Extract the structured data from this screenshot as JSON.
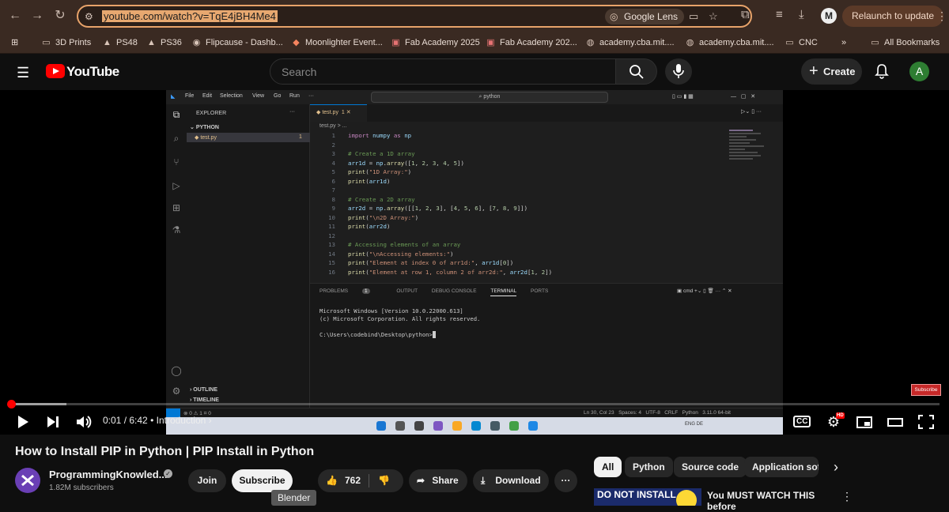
{
  "browser": {
    "url": "youtube.com/watch?v=TqE4jBH4Me4",
    "lens_label": "Google Lens",
    "relaunch_label": "Relaunch to update",
    "profile_letter": "M",
    "bookmarks": [
      "3D Prints",
      "PS48",
      "PS36",
      "Flipcause - Dashb...",
      "Moonlighter Event...",
      "Fab Academy 2025",
      "Fab Academy 202...",
      "academy.cba.mit....",
      "academy.cba.mit....",
      "CNC",
      "All Bookmarks"
    ]
  },
  "youtube": {
    "logo_text": "YouTube",
    "search_placeholder": "Search",
    "create_label": "Create",
    "avatar_letter": "A"
  },
  "vscode": {
    "menu": [
      "File",
      "Edit",
      "Selection",
      "View",
      "Go",
      "Run"
    ],
    "command_center": "python",
    "explorer_title": "EXPLORER",
    "folder": "PYTHON",
    "file": "test.py",
    "file_badge": "1",
    "tab_label": "test.py",
    "tab_badge": "1",
    "breadcrumb": "test.py > ...",
    "outline": "OUTLINE",
    "timeline": "TIMELINE",
    "code_lines": [
      "import numpy as np",
      "",
      "# Create a 1D array",
      "arr1d = np.array([1, 2, 3, 4, 5])",
      "print(\"1D Array:\")",
      "print(arr1d)",
      "",
      "# Create a 2D array",
      "arr2d = np.array([[1, 2, 3], [4, 5, 6], [7, 8, 9]])",
      "print(\"\\n2D Array:\")",
      "print(arr2d)",
      "",
      "# Accessing elements of an array",
      "print(\"\\nAccessing elements:\")",
      "print(\"Element at index 0 of arr1d:\", arr1d[0])",
      "print(\"Element at row 1, column 2 of arr2d:\", arr2d[1, 2])"
    ],
    "panel_tabs": [
      "PROBLEMS",
      "OUTPUT",
      "DEBUG CONSOLE",
      "TERMINAL",
      "PORTS"
    ],
    "problems_count": "1",
    "terminal_shell": "cmd",
    "terminal_lines": [
      "Microsoft Windows [Version 10.0.22000.613]",
      "(c) Microsoft Corporation. All rights reserved.",
      "",
      "C:\\Users\\codebind\\Desktop\\python>"
    ],
    "status_left": "⊗ 0 ⚠ 1   ⌗ 0",
    "status_right": "Ln 30, Col 23   Spaces: 4   UTF-8   CRLF   Python   3.11.0 64-bit",
    "taskbar_lang": "ENG DE"
  },
  "player": {
    "watermark": "Subscribe",
    "progress_fraction": 0.002,
    "time_current": "0:01",
    "time_total": "6:42",
    "chapter": "Introduction",
    "hd_badge": "HD"
  },
  "video": {
    "title": "How to Install PIP in Python | PIP Install in Python",
    "channel": "ProgrammingKnowled...",
    "subscribers": "1.82M subscribers",
    "join_label": "Join",
    "subscribe_label": "Subscribe",
    "likes": "762",
    "share_label": "Share",
    "download_label": "Download",
    "tooltip": "Blender"
  },
  "chips": [
    "All",
    "Python",
    "Source code",
    "Application soft"
  ],
  "recommendation": {
    "thumb_text": "DO NOT INSTALL",
    "title": "You MUST WATCH THIS before"
  }
}
